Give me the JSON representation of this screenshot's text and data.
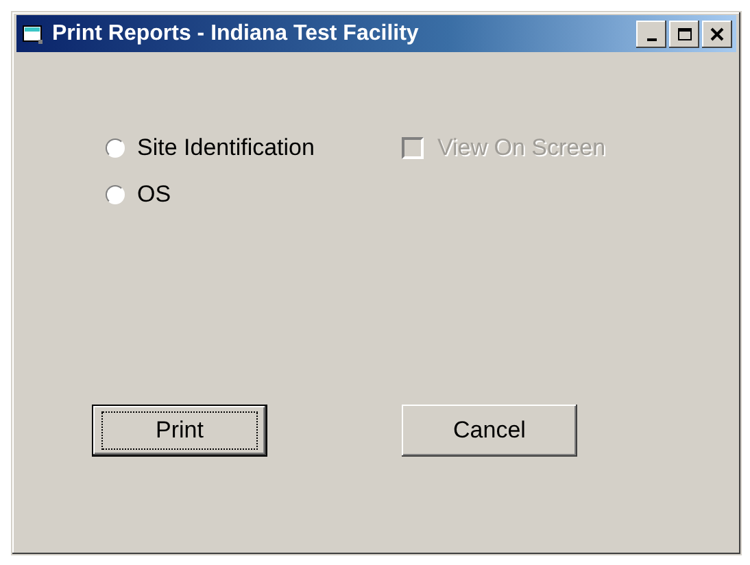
{
  "window": {
    "title": "Print Reports - Indiana Test Facility"
  },
  "report_options": [
    {
      "label": "Site Identification",
      "selected": false
    },
    {
      "label": "OS",
      "selected": false
    }
  ],
  "view_on_screen": {
    "label": "View On Screen",
    "checked": false,
    "disabled": true
  },
  "buttons": [
    {
      "label": "Print",
      "default": true
    },
    {
      "label": "Cancel",
      "default": false
    }
  ]
}
